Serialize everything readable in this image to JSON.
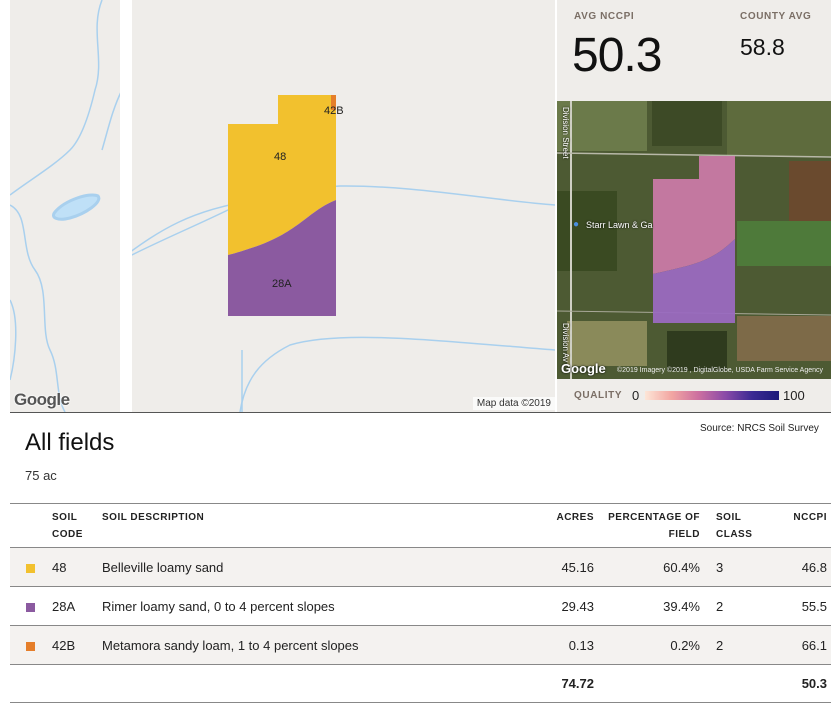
{
  "map": {
    "labels": [
      "48",
      "42B",
      "28A"
    ],
    "google_logo": "Google",
    "credit": "Map data ©2019"
  },
  "stats": {
    "avg_label": "AVG NCCPI",
    "avg_value": "50.3",
    "county_label": "COUNTY AVG",
    "county_value": "58.8"
  },
  "satellite": {
    "street_1": "Division Street",
    "street_2": "Division Av",
    "poi": "Starr Lawn & Ga",
    "google_logo": "Google",
    "credit": "©2019 Imagery ©2019 , DigitalGlobe, USDA Farm Service Agency"
  },
  "quality": {
    "label": "QUALITY",
    "min": "0",
    "max": "100"
  },
  "source": "Source: NRCS Soil Survey",
  "title": "All fields",
  "total_acres": "75 ac",
  "table": {
    "headers": {
      "soil_code": [
        "SOIL",
        "CODE"
      ],
      "soil_description": "SOIL DESCRIPTION",
      "acres": "ACRES",
      "percentage": [
        "PERCENTAGE OF",
        "FIELD"
      ],
      "soil_class": [
        "SOIL",
        "CLASS"
      ],
      "nccpi": "NCCPI"
    },
    "rows": [
      {
        "color": "#f2c12e",
        "code": "48",
        "description": "Belleville loamy sand",
        "acres": "45.16",
        "percentage": "60.4%",
        "soil_class": "3",
        "nccpi": "46.8"
      },
      {
        "color": "#8b5aa0",
        "code": "28A",
        "description": "Rimer loamy sand, 0 to 4 percent slopes",
        "acres": "29.43",
        "percentage": "39.4%",
        "soil_class": "2",
        "nccpi": "55.5"
      },
      {
        "color": "#e57e2a",
        "code": "42B",
        "description": "Metamora sandy loam, 1 to 4 percent slopes",
        "acres": "0.13",
        "percentage": "0.2%",
        "soil_class": "2",
        "nccpi": "66.1"
      }
    ],
    "totals": {
      "acres": "74.72",
      "nccpi": "50.3"
    }
  }
}
